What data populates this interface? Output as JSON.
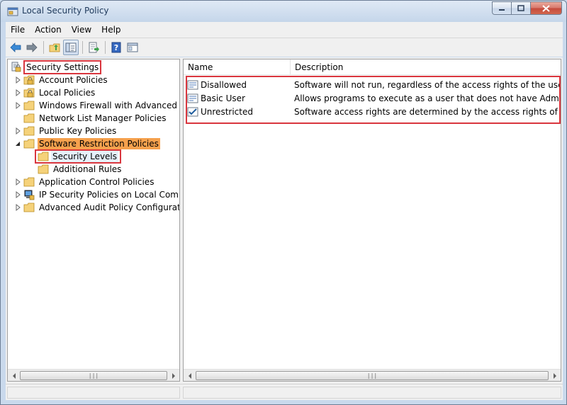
{
  "window": {
    "title": "Local Security Policy"
  },
  "menu": [
    {
      "label": "File"
    },
    {
      "label": "Action"
    },
    {
      "label": "View"
    },
    {
      "label": "Help"
    }
  ],
  "toolbar": {
    "buttons": [
      "back-icon",
      "forward-icon",
      "up-folder-icon",
      "show-hide-tree-icon",
      "export-list-icon",
      "help-icon",
      "properties-icon"
    ]
  },
  "tree": {
    "root": "Security Settings",
    "items": [
      {
        "label": "Account Policies"
      },
      {
        "label": "Local Policies"
      },
      {
        "label": "Windows Firewall with Advanced Security"
      },
      {
        "label": "Network List Manager Policies"
      },
      {
        "label": "Public Key Policies"
      },
      {
        "label": "Software Restriction Policies"
      },
      {
        "label": "Security Levels"
      },
      {
        "label": "Additional Rules"
      },
      {
        "label": "Application Control Policies"
      },
      {
        "label": "IP Security Policies on Local Computer"
      },
      {
        "label": "Advanced Audit Policy Configuration"
      }
    ]
  },
  "list": {
    "columns": [
      "Name",
      "Description"
    ],
    "rows": [
      {
        "name": "Disallowed",
        "description": "Software will not run, regardless of the access rights of the user."
      },
      {
        "name": "Basic User",
        "description": "Allows programs to execute as a user that does not have Administrator or Power User access rights."
      },
      {
        "name": "Unrestricted",
        "description": "Software access rights are determined by the access rights of the user."
      }
    ]
  },
  "colors": {
    "selection": "#f6a14d",
    "highlight_box": "#d9363e",
    "folder": "#f5d27a"
  }
}
